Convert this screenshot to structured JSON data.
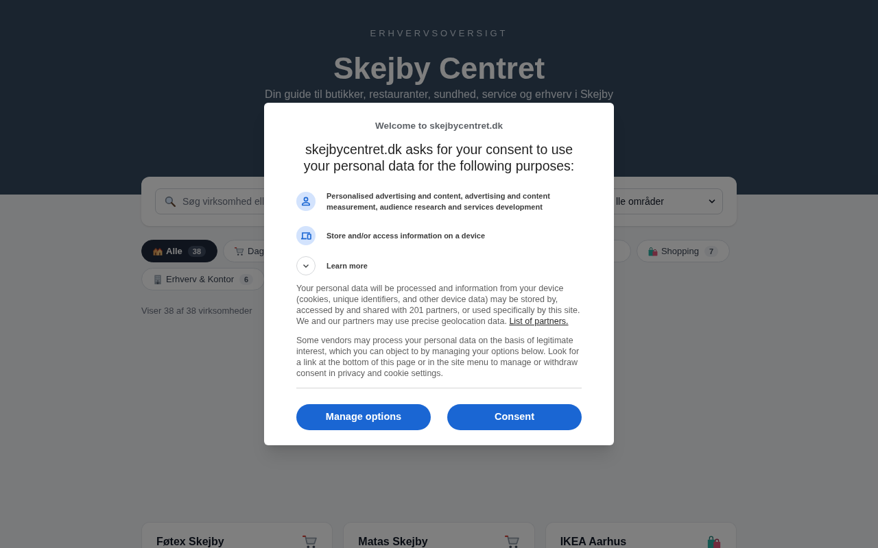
{
  "header": {
    "eyebrow": "ERHVERVSOVERSIGT",
    "title": "Skejby Centret",
    "subtitle": "Din guide til butikker, restauranter, sundhed, service og erhverv i Skejby"
  },
  "search": {
    "placeholder": "Søg virksomhed ell",
    "area": "lle områder"
  },
  "filters": [
    [
      {
        "kind": "all",
        "label": "Alle",
        "count": "38",
        "selected": true
      },
      {
        "kind": "groceries",
        "label": "Dag",
        "selected": false
      },
      {
        "selected": false
      },
      {
        "kind": "shopping",
        "label": "Shopping",
        "count": "7",
        "selected": false
      }
    ],
    [
      {
        "kind": "business",
        "label": "Erhverv & Kontor",
        "count": "6",
        "selected": false
      }
    ]
  ],
  "result_count": "Viser 38 af 38 virksomheder",
  "cards": [
    {
      "name": "Føtex Skejby",
      "kind": "groceries"
    },
    {
      "name": "Matas Skejby",
      "kind": "groceries"
    },
    {
      "name": "IKEA Aarhus",
      "kind": "shopping"
    }
  ],
  "consent_dialog": {
    "welcome": "Welcome to skejbycentret.dk",
    "heading": "skejbycentret.dk asks for your consent to use your personal data for the following purposes:",
    "purposes": [
      {
        "kind": "person",
        "text": "Personalised advertising and content, advertising and content measurement, audience research and services development"
      },
      {
        "kind": "device",
        "text": "Store and/or access information on a device"
      }
    ],
    "learn_more": "Learn more",
    "paragraphs": [
      {
        "text": "Your personal data will be processed and information from your device (cookies, unique identifiers, and other device data) may be stored by, accessed by and shared with 201 partners, or used specifically by this site. We and our partners may use precise geolocation data.",
        "link": "List of partners."
      },
      {
        "text": "Some vendors may process your personal data on the basis of legitimate interest, which you can object to by managing your options below. Look for a link at the bottom of this page or in the site menu to manage or withdraw consent in privacy and cookie settings."
      }
    ],
    "buttons": [
      "Manage options",
      "Consent"
    ]
  }
}
